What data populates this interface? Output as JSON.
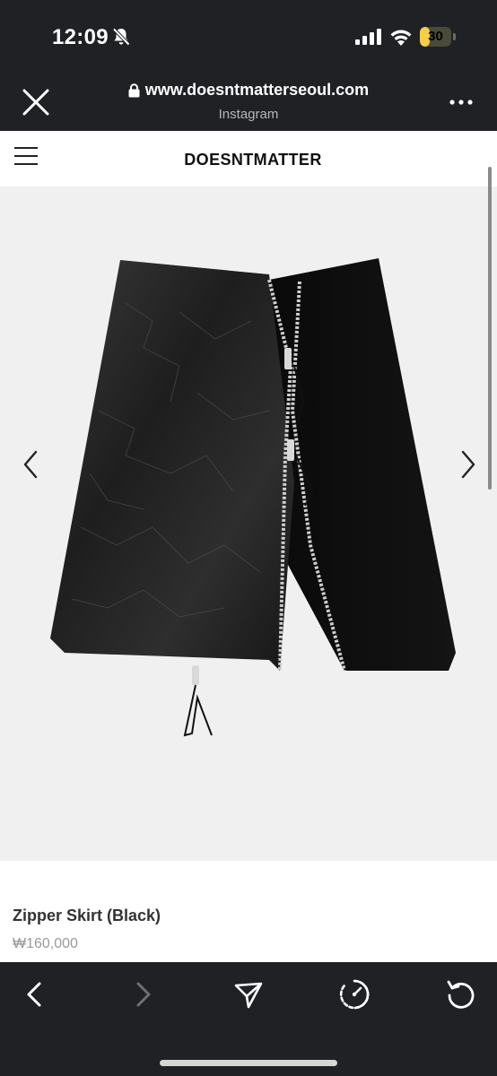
{
  "status_bar": {
    "time": "12:09",
    "battery_level": "30",
    "battery_fraction": 0.3,
    "battery_color": "#f7ce45",
    "icons": [
      "bell-slash-icon",
      "cellular-signal-icon",
      "wifi-icon",
      "battery-icon"
    ]
  },
  "browser": {
    "url": "www.doesntmatterseoul.com",
    "source_app": "Instagram",
    "icons": [
      "close-icon",
      "lock-icon",
      "more-icon"
    ]
  },
  "site": {
    "brand": "DOESNTMATTER",
    "icons": [
      "hamburger-menu-icon",
      "chevron-left-icon",
      "chevron-right-icon"
    ]
  },
  "product": {
    "name": "Zipper Skirt (Black)",
    "price": "₩160,000"
  },
  "toolbar": {
    "icons": [
      "back-icon",
      "forward-icon",
      "share-icon",
      "speed-icon",
      "reload-icon"
    ]
  },
  "colors": {
    "chrome_background": "#1f2125",
    "page_background": "#ffffff",
    "gallery_background": "#f0f0f0"
  }
}
